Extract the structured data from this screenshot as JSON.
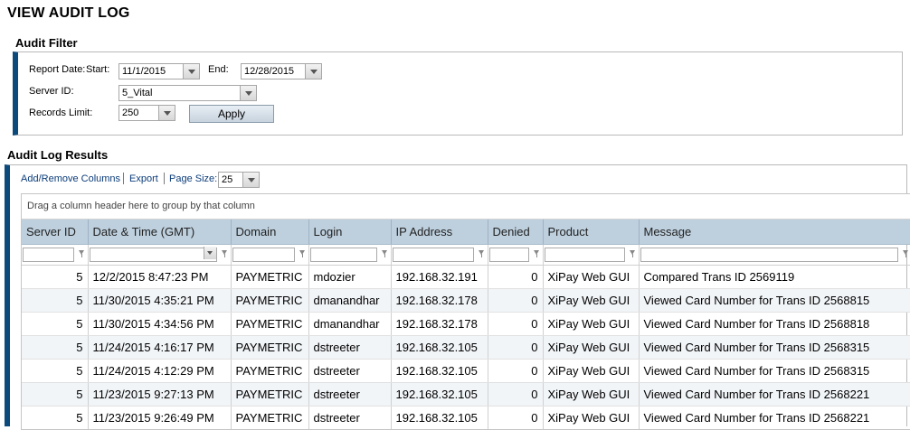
{
  "page_title": "VIEW AUDIT LOG",
  "filter": {
    "title": "Audit Filter",
    "report_date_label": "Report Date:",
    "start_label": "Start:",
    "start_value": "11/1/2015",
    "end_label": "End:",
    "end_value": "12/28/2015",
    "server_id_label": "Server ID:",
    "server_id_value": "5_Vital",
    "records_limit_label": "Records Limit:",
    "records_limit_value": "250",
    "apply_label": "Apply"
  },
  "results": {
    "title": "Audit Log Results",
    "toolbar": {
      "add_remove": "Add/Remove Columns",
      "export": "Export",
      "page_size_label": "Page Size:",
      "page_size_value": "25"
    },
    "group_hint": "Drag a column header here to group by that column",
    "columns": [
      "Server ID",
      "Date & Time (GMT)",
      "Domain",
      "Login",
      "IP Address",
      "Denied",
      "Product",
      "Message"
    ],
    "rows": [
      [
        "5",
        "12/2/2015 8:47:23 PM",
        "PAYMETRIC",
        "mdozier",
        "192.168.32.191",
        "0",
        "XiPay Web GUI",
        "Compared Trans ID 2569119"
      ],
      [
        "5",
        "11/30/2015 4:35:21 PM",
        "PAYMETRIC",
        "dmanandhar",
        "192.168.32.178",
        "0",
        "XiPay Web GUI",
        "Viewed Card Number for Trans ID 2568815"
      ],
      [
        "5",
        "11/30/2015 4:34:56 PM",
        "PAYMETRIC",
        "dmanandhar",
        "192.168.32.178",
        "0",
        "XiPay Web GUI",
        "Viewed Card Number for Trans ID 2568818"
      ],
      [
        "5",
        "11/24/2015 4:16:17 PM",
        "PAYMETRIC",
        "dstreeter",
        "192.168.32.105",
        "0",
        "XiPay Web GUI",
        "Viewed Card Number for Trans ID 2568315"
      ],
      [
        "5",
        "11/24/2015 4:12:29 PM",
        "PAYMETRIC",
        "dstreeter",
        "192.168.32.105",
        "0",
        "XiPay Web GUI",
        "Viewed Card Number for Trans ID 2568315"
      ],
      [
        "5",
        "11/23/2015 9:27:13 PM",
        "PAYMETRIC",
        "dstreeter",
        "192.168.32.105",
        "0",
        "XiPay Web GUI",
        "Viewed Card Number for Trans ID 2568221"
      ],
      [
        "5",
        "11/23/2015 9:26:49 PM",
        "PAYMETRIC",
        "dstreeter",
        "192.168.32.105",
        "0",
        "XiPay Web GUI",
        "Viewed Card Number for Trans ID 2568221"
      ]
    ]
  },
  "colors": {
    "accent_bar": "#0d4a7c",
    "header_bg": "#bed0de",
    "link": "#0b3c7a"
  }
}
